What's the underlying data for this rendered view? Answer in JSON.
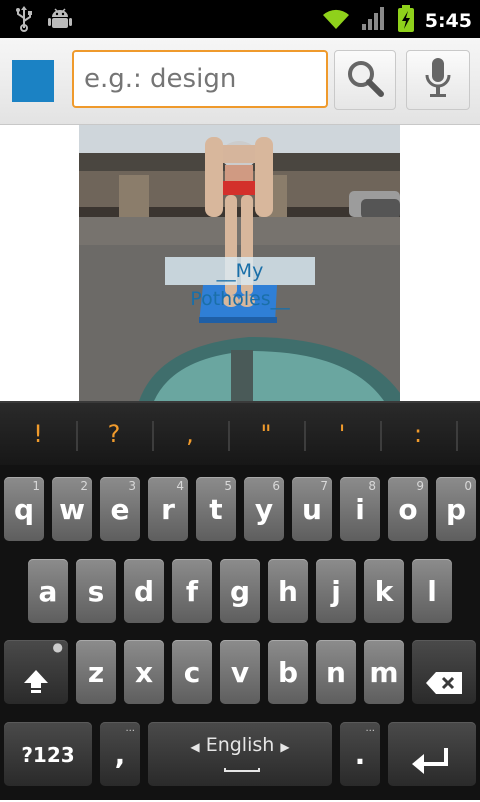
{
  "status_bar": {
    "time": "5:45",
    "left_icons": [
      "usb-icon",
      "android-debug-icon"
    ],
    "right_icons": [
      "wifi-icon",
      "signal-icon",
      "battery-charging-icon"
    ]
  },
  "search_bar": {
    "placeholder": "e.g.: design",
    "value": "",
    "accent_color": "#ef9a2c",
    "app_color": "#1b82c4"
  },
  "photo": {
    "caption": "__My Potholes__"
  },
  "suggestions": [
    "!",
    "?",
    ",",
    "\"",
    "'",
    ":"
  ],
  "keyboard": {
    "row1": [
      {
        "key": "q",
        "hint": "1"
      },
      {
        "key": "w",
        "hint": "2"
      },
      {
        "key": "e",
        "hint": "3"
      },
      {
        "key": "r",
        "hint": "4"
      },
      {
        "key": "t",
        "hint": "5"
      },
      {
        "key": "y",
        "hint": "6"
      },
      {
        "key": "u",
        "hint": "7"
      },
      {
        "key": "i",
        "hint": "8"
      },
      {
        "key": "o",
        "hint": "9"
      },
      {
        "key": "p",
        "hint": "0"
      }
    ],
    "row2": [
      "a",
      "s",
      "d",
      "f",
      "g",
      "h",
      "j",
      "k",
      "l"
    ],
    "row3": [
      "z",
      "x",
      "c",
      "v",
      "b",
      "n",
      "m"
    ],
    "symbols_label": "?123",
    "comma_label": ",",
    "space_label": "English",
    "period_label": "."
  }
}
